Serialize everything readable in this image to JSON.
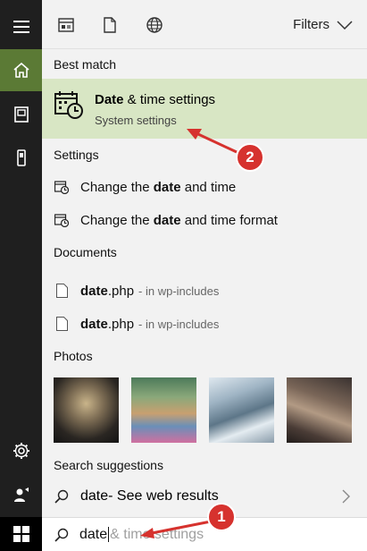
{
  "toolbar": {
    "filters_label": "Filters"
  },
  "sections": {
    "best_match": "Best match",
    "settings": "Settings",
    "documents": "Documents",
    "photos": "Photos",
    "search_suggestions": "Search suggestions"
  },
  "best_match": {
    "title_bold": "Date",
    "title_rest": " & time settings",
    "subtitle": "System settings"
  },
  "settings_items": [
    {
      "pre": "Change the ",
      "bold": "date",
      "post": " and time"
    },
    {
      "pre": "Change the ",
      "bold": "date",
      "post": " and time format"
    }
  ],
  "documents": [
    {
      "name_bold": "date",
      "name_rest": ".php",
      "location": "- in wp-includes"
    },
    {
      "name_bold": "date",
      "name_rest": ".php",
      "location": "- in wp-includes"
    }
  ],
  "suggestion": {
    "term": "date",
    "meta": "- See web results"
  },
  "search": {
    "typed": "date",
    "completion": "& time settings"
  },
  "annotations": {
    "badge_1": "1",
    "badge_2": "2"
  },
  "colors": {
    "rail": "#1f1f1f",
    "rail_active": "#5b7a35",
    "best_match_bg": "#d8e6c4",
    "panel_bg": "#f2f2f2",
    "annotation_red": "#d6322e"
  },
  "icons": {
    "menu": "hamburger-icon",
    "home": "home-icon",
    "notebook": "notebook-icon",
    "device": "device-icon",
    "settings": "gear-icon",
    "feedback": "person-icon",
    "start": "windows-logo-icon"
  }
}
